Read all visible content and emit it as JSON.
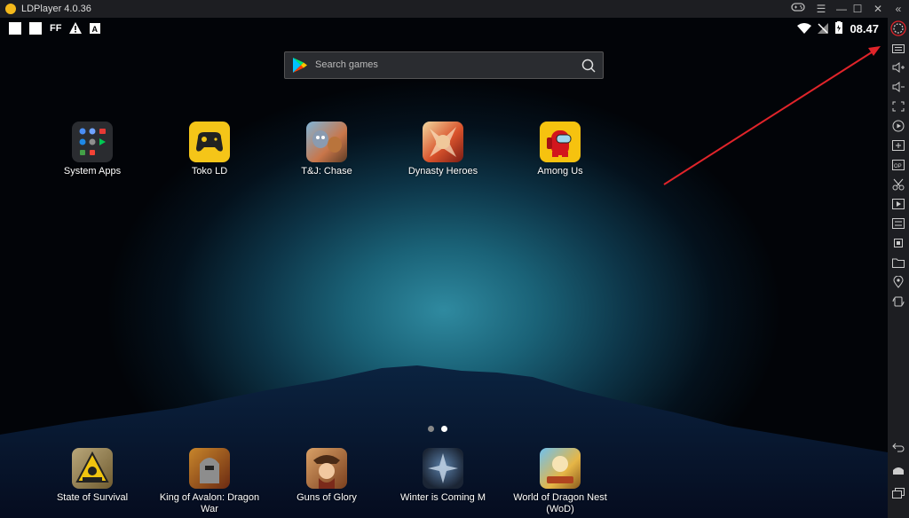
{
  "window": {
    "title": "LDPlayer 4.0.36",
    "controls": {
      "gamepad": "gamepad-icon",
      "menu": "☰",
      "minimize": "—",
      "maximize": "☐",
      "close": "✕"
    }
  },
  "statusbar": {
    "left_text": "FF",
    "clock": "08.47"
  },
  "search": {
    "placeholder": "Search games"
  },
  "top_apps": [
    {
      "label": "System Apps"
    },
    {
      "label": "Toko LD"
    },
    {
      "label": "T&J: Chase"
    },
    {
      "label": "Dynasty Heroes"
    },
    {
      "label": "Among Us"
    }
  ],
  "dock_apps": [
    {
      "label": "State of Survival"
    },
    {
      "label": "King of Avalon: Dragon War"
    },
    {
      "label": "Guns of Glory"
    },
    {
      "label": "Winter is Coming M"
    },
    {
      "label": "World of Dragon Nest (WoD)"
    }
  ],
  "page_indicator": {
    "count": 2,
    "active": 2
  },
  "sidebar": {
    "collapse": "«",
    "tools": [
      "settings-icon",
      "keyboard-icon",
      "volume-up-icon",
      "volume-down-icon",
      "screenshot-icon",
      "record-icon",
      "add-apk-icon",
      "macro-icon",
      "cut-icon",
      "video-icon",
      "sync-icon",
      "cpu-icon",
      "folder-icon",
      "location-icon",
      "rotate-icon"
    ],
    "bottom": [
      "back-icon",
      "home-icon",
      "recents-icon"
    ]
  },
  "colors": {
    "accent": "#f3b81b",
    "annotation": "#e0242a",
    "sidebar": "#1d1e22"
  }
}
